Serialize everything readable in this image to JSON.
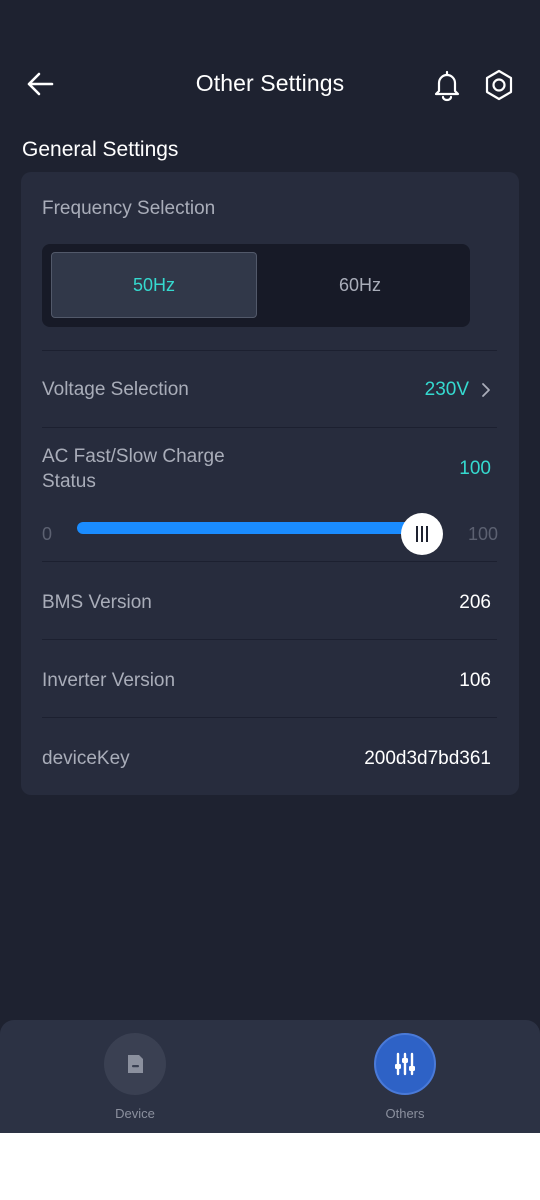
{
  "header": {
    "title": "Other Settings",
    "back_icon": "arrow-left-icon",
    "notification_icon": "bell-icon",
    "settings_icon": "gear-icon"
  },
  "section": {
    "title": "General Settings"
  },
  "frequency": {
    "label": "Frequency Selection",
    "options": [
      "50Hz",
      "60Hz"
    ],
    "selected": "50Hz"
  },
  "voltage": {
    "label": "Voltage Selection",
    "value": "230V"
  },
  "ac_charge": {
    "label": "AC Fast/Slow Charge Status",
    "value": "100",
    "min": "0",
    "max": "100",
    "level": 1.0
  },
  "bms": {
    "label": "BMS Version",
    "value": "206"
  },
  "inverter": {
    "label": "Inverter Version",
    "value": "106"
  },
  "device_key": {
    "label": "deviceKey",
    "value": "200d3d7bd361"
  },
  "nav": {
    "items": [
      {
        "label": "Device",
        "icon": "device-icon",
        "active": false
      },
      {
        "label": "Others",
        "icon": "sliders-icon",
        "active": true
      }
    ]
  },
  "colors": {
    "background": "#1e2230",
    "card": "#272c3d",
    "accent": "#35d9cf",
    "slider": "#1a8cff",
    "nav_active": "#2e62c6"
  }
}
